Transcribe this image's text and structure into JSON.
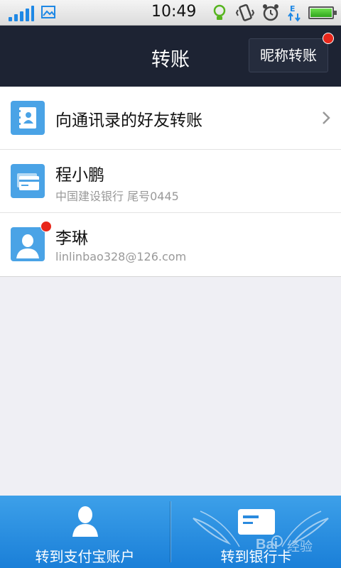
{
  "status_bar": {
    "time": "10:49"
  },
  "header": {
    "title": "转账",
    "nickname_button": "昵称转账"
  },
  "list": {
    "contacts_entry": "向通讯录的好友转账",
    "items": [
      {
        "name": "程小鹏",
        "detail": "中国建设银行 尾号0445",
        "icon": "bank-card-icon"
      },
      {
        "name": "李琳",
        "detail": "linlinbao328@126.com",
        "icon": "person-icon"
      }
    ]
  },
  "bottom_tabs": [
    {
      "label": "转到支付宝账户",
      "icon": "person-icon"
    },
    {
      "label": "转到银行卡",
      "icon": "bank-card-icon"
    }
  ],
  "watermark": {
    "brand": "Bai",
    "suffix": "经验"
  },
  "colors": {
    "header_bg": "#1d2333",
    "accent_blue": "#1a7fd8",
    "badge_red": "#e8271b"
  }
}
